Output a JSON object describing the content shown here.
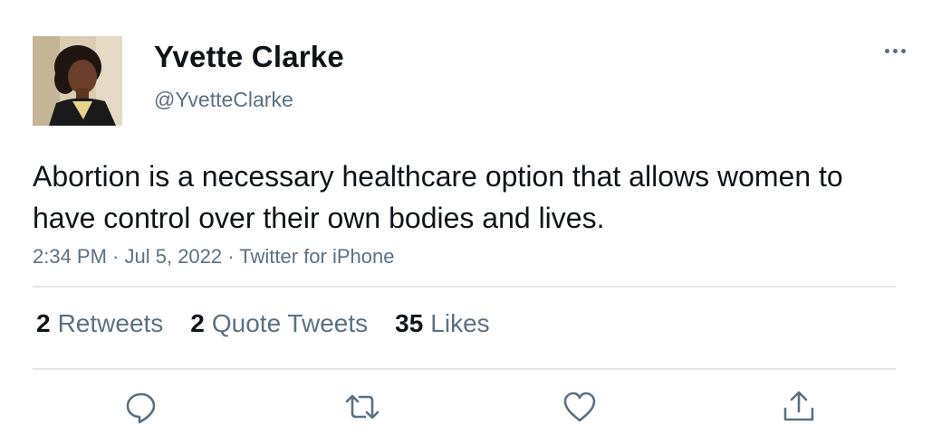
{
  "author": {
    "display_name": "Yvette Clarke",
    "handle": "@YvetteClarke"
  },
  "tweet": {
    "text": "Abortion is a necessary healthcare option that allows women to have control over their own bodies and lives.",
    "time": "2:34 PM",
    "date": "Jul 5, 2022",
    "source": "Twitter for iPhone",
    "separator": " · "
  },
  "stats": {
    "retweets_count": "2",
    "retweets_label": "Retweets",
    "quotes_count": "2",
    "quotes_label": "Quote Tweets",
    "likes_count": "35",
    "likes_label": "Likes"
  },
  "icons": {
    "more": "more-horizontal-icon",
    "reply": "reply-icon",
    "retweet": "retweet-icon",
    "like": "heart-icon",
    "share": "share-icon"
  },
  "colors": {
    "text": "#0f1419",
    "secondary": "#5b7083",
    "divider": "#e1e5e8"
  }
}
